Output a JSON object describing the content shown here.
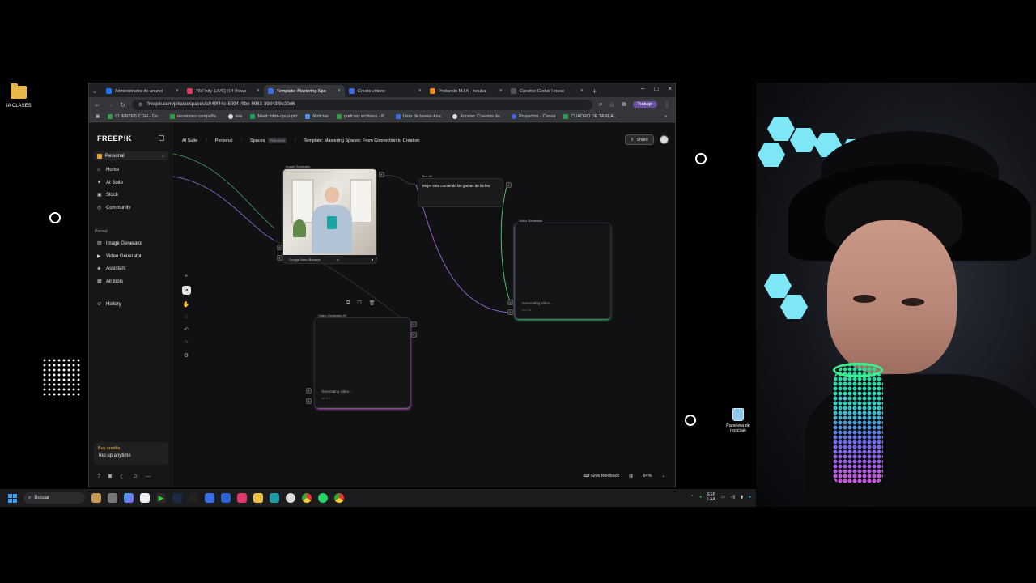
{
  "desktop": {
    "folder_label": "IA CLASES",
    "recycle_label": "Papelera de reciclaje"
  },
  "browser": {
    "tabs": [
      {
        "label": "Administrador de anunci",
        "color": "#1877f2"
      },
      {
        "label": "TikFinity [LIVE] (14 Views",
        "color": "#e03b5b"
      },
      {
        "label": "Template: Mastering Spa",
        "color": "#3a6ee8",
        "active": true
      },
      {
        "label": "Create videos",
        "color": "#3a6ee8"
      },
      {
        "label": "Protocolo MJ.A - Incuba",
        "color": "#f08a24"
      },
      {
        "label": "Creative Global House",
        "color": "#555555"
      }
    ],
    "url": "freepik.com/pikaso/spaces/a049f44e-5094-4fbe-9983-39d43f9e20d6",
    "profile_label": "Trabajo",
    "bookmarks": [
      {
        "label": "CLIENTES CGH - Go...",
        "color": "#2e9c4a"
      },
      {
        "label": "reuniones campaña...",
        "color": "#2e9c4a"
      },
      {
        "label": "rive",
        "color": "#dddddd"
      },
      {
        "label": "Meet: nhm-cpuo-pct",
        "color": "#1f9c5b"
      },
      {
        "label": "Noticias",
        "color": "#4a8ef0"
      },
      {
        "label": "podcast archivos - P...",
        "color": "#2e9c4a"
      },
      {
        "label": "Lista de tareas Ana...",
        "color": "#3a6ee8"
      },
      {
        "label": "Acceso: Cuentas de...",
        "color": "#dddddd"
      },
      {
        "label": "Proyectos - Canva",
        "color": "#3a6ee8"
      },
      {
        "label": "CUADRO DE TAREA...",
        "color": "#2e9c4a"
      }
    ]
  },
  "app": {
    "logo": "FREEP!K",
    "workspace": "Personal",
    "nav": {
      "home": "Home",
      "ai_suite": "AI Suite",
      "stock": "Stock",
      "community": "Community"
    },
    "pinned_label": "Pinned",
    "pinned": {
      "image_generator": "Image Generator",
      "video_generator": "Video Generator",
      "assistant": "Assistant",
      "all_tools": "All tools"
    },
    "history": "History",
    "credits": {
      "title": "Buy credits",
      "subtitle": "Top up anytime"
    },
    "breadcrumb": {
      "ai_suite": "AI Suite",
      "personal": "Personal",
      "spaces": "Spaces",
      "preview": "PREVIEW",
      "title": "Template: Mastering Spaces: From Connection to Creation"
    },
    "share_label": "Share",
    "canvas": {
      "image_node": {
        "title": "Image Generator",
        "footer": "Google Nano Banana"
      },
      "text_node": {
        "title": "Text #4",
        "text": "Mujer esta comiendo las gomas de bichiw"
      },
      "video_node_1": {
        "title": "Video Generator",
        "status": "Generating video...",
        "sub": "8m 23s"
      },
      "video_node_2": {
        "title": "Video Generator #2",
        "status": "Generating video...",
        "sub": "8m 37s"
      }
    },
    "feedback_label": "Give feedback",
    "zoom": "64%"
  },
  "taskbar": {
    "search_placeholder": "Buscar",
    "lang_top": "ESP",
    "lang_bottom": "LAA"
  }
}
